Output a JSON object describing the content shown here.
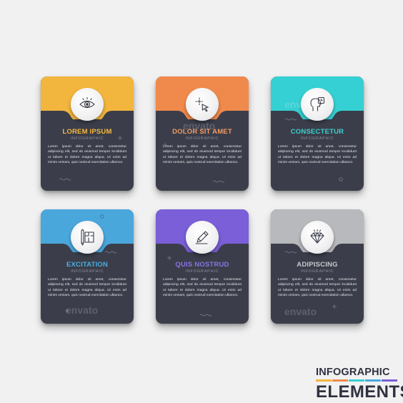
{
  "cards": [
    {
      "title": "LOREM IPSUM",
      "color": "#f2b53d",
      "title_color": "#f6b93c",
      "icon": "eye-icon"
    },
    {
      "title": "DOLOR SIT AMET",
      "color": "#f08a4c",
      "title_color": "#f39a63",
      "icon": "cursor-icon"
    },
    {
      "title": "CONSECTETUR",
      "color": "#35d0d3",
      "title_color": "#3fd0d2",
      "icon": "head-clock-icon"
    },
    {
      "title": "EXCITATION",
      "color": "#4aa7dc",
      "title_color": "#4aaee2",
      "icon": "blueprint-icon"
    },
    {
      "title": "QUIS NOSTRUD",
      "color": "#7a5fd8",
      "title_color": "#8a73e6",
      "icon": "pencil-icon"
    },
    {
      "title": "ADIPISCING",
      "color": "#b8b9bc",
      "title_color": "#c7c8cb",
      "icon": "diamond-icon"
    }
  ],
  "subtitle": "INFOGRAPHIC",
  "body_text": "Lorem ipsum dolor sit amet, consectetur adipiscing elit, sed do eiusmod tempor incididunt ut labore et dolore magna aliqua. Ut enim ad minim veniam, quis nostrud exercitation ullamco.",
  "watermark": "envato",
  "brand": {
    "line1": "INFOGRAPHIC",
    "line2": "ELEMENTS"
  },
  "accent_bars": [
    "#f2b53d",
    "#f08a4c",
    "#35d0d3",
    "#4aa7dc",
    "#7a5fd8"
  ]
}
